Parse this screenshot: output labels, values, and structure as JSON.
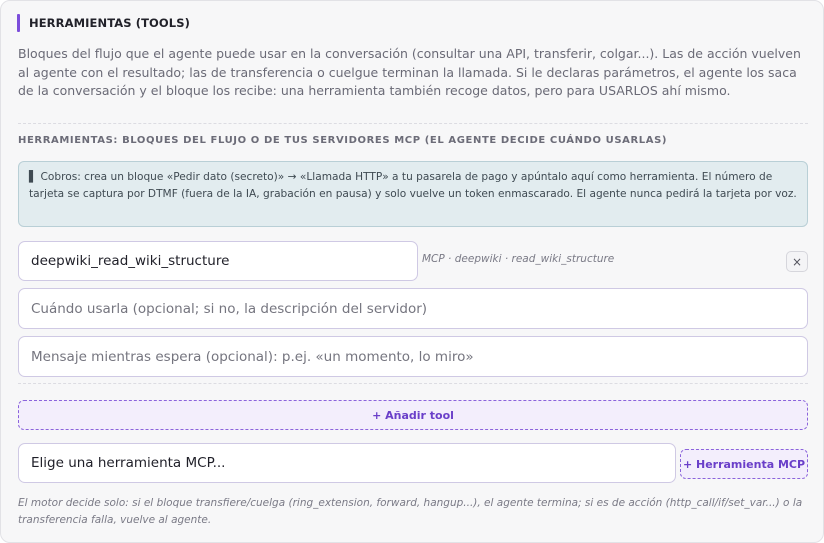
{
  "section": {
    "title": "HERRAMIENTAS (TOOLS)",
    "description": "Bloques del flujo que el agente puede usar en la conversación (consultar una API, transferir, colgar...). Las de acción vuelven al agente con el resultado; las de transferencia o cuelgue terminan la llamada. Si le declaras parámetros, el agente los saca de la conversación y el bloque los recibe: una herramienta también recoge datos, pero para USARLOS ahí mismo.",
    "subheading": "HERRAMIENTAS: BLOQUES DEL FLUJO O DE TUS SERVIDORES MCP (EL AGENTE DECIDE CUÁNDO USARLAS)",
    "info_note": "▌ Cobros: crea un bloque «Pedir dato (secreto)» → «Llamada HTTP» a tu pasarela de pago y apúntalo aquí como herramienta. El número de tarjeta se captura por DTMF (fuera de la IA, grabación en pausa) y solo vuelve un token enmascarado. El agente nunca pedirá la tarjeta por voz."
  },
  "tool": {
    "name_value": "deepwiki_read_wiki_structure",
    "source_tag": "MCP · deepwiki · read_wiki_structure",
    "remove_label": "×",
    "when_placeholder": "Cuándo usarla (opcional; si no, la descripción del servidor)",
    "waiting_placeholder": "Mensaje mientras espera (opcional): p.ej. «un momento, lo miro»"
  },
  "actions": {
    "add_tool_label": "+ Añadir tool",
    "mcp_select_placeholder": "Elige una herramienta MCP...",
    "add_mcp_label": "+ Herramienta MCP"
  },
  "footer_note": "El motor decide solo: si el bloque transfiere/cuelga (ring_extension, forward, hangup...), el agente termina; si es de acción (http_call/if/set_var...) o la transferencia falla, vuelve al agente.",
  "colors": {
    "accent": "#7c4ddb",
    "info_bg": "#e2ecef"
  }
}
